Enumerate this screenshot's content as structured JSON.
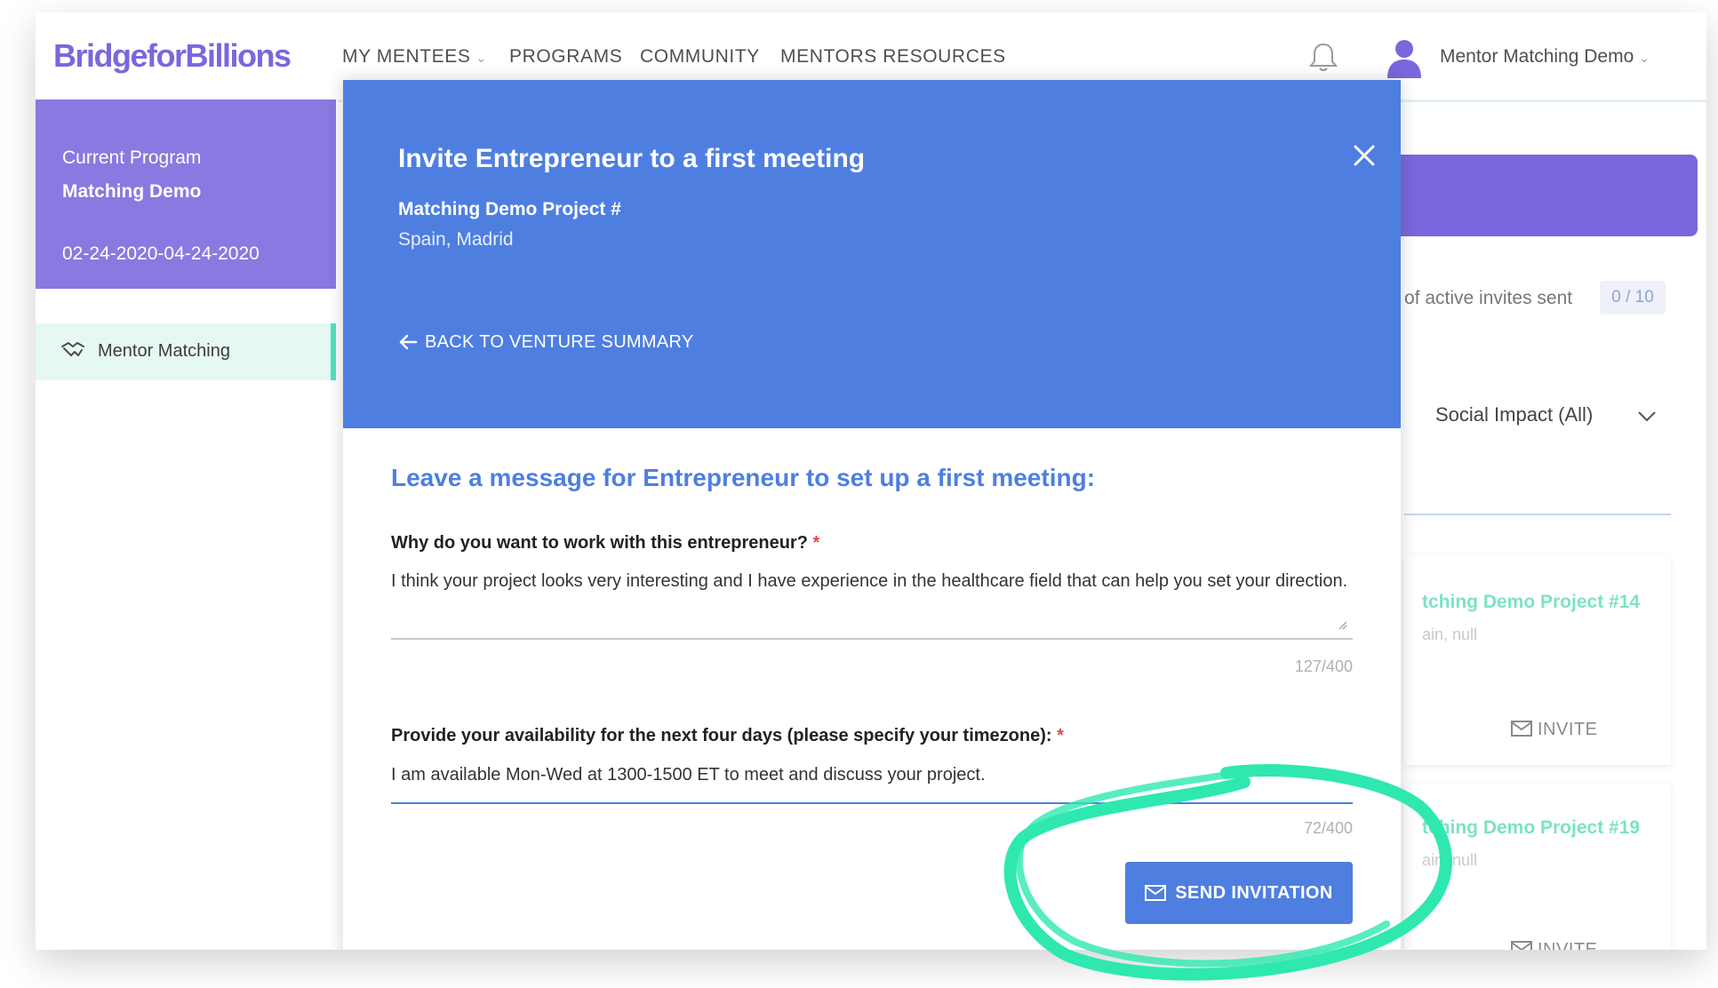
{
  "brand": {
    "name": "BridgeforBillions"
  },
  "nav": {
    "items": [
      {
        "label": "MY MENTEES",
        "has_dropdown": true
      },
      {
        "label": "PROGRAMS"
      },
      {
        "label": "COMMUNITY"
      },
      {
        "label": "MENTORS RESOURCES"
      }
    ],
    "user_name": "Mentor Matching Demo"
  },
  "sidebar": {
    "current_program_label": "Current Program",
    "program_name": "Matching Demo",
    "program_dates": "02-24-2020-04-24-2020",
    "item_label": "Mentor Matching"
  },
  "background": {
    "invites_text": "of active invites sent",
    "invites_count": "0 / 10",
    "filter_value": "Social Impact (All)",
    "cards": [
      {
        "title": "tching Demo Project #14",
        "subtitle": "ain, null",
        "invite_label": "INVITE"
      },
      {
        "title": "tching Demo Project #19",
        "subtitle": "ain, null",
        "invite_label": "INVITE"
      }
    ]
  },
  "modal": {
    "title": "Invite Entrepreneur to a first meeting",
    "project_name": "Matching Demo Project #",
    "project_location": "Spain, Madrid",
    "back_link": "BACK TO VENTURE SUMMARY",
    "section_title": "Leave a message for Entrepreneur to set up a first meeting:",
    "question1": {
      "label": "Why do you want to work with this entrepreneur?",
      "required_mark": "*",
      "answer": "I think your project looks very interesting and I have experience in the healthcare field that can help you set your direction.",
      "counter": "127/400"
    },
    "question2": {
      "label": "Provide your availability for the next four days (please specify your timezone):",
      "required_mark": "*",
      "answer": "I am available Mon-Wed at 1300-1500 ET to meet and discuss your project.",
      "counter": "72/400"
    },
    "send_button": "SEND INVITATION"
  },
  "colors": {
    "brand_purple": "#7a67dd",
    "modal_blue": "#4e7fe0",
    "highlight_green": "#2ee8b0",
    "required_red": "#e5484d"
  }
}
